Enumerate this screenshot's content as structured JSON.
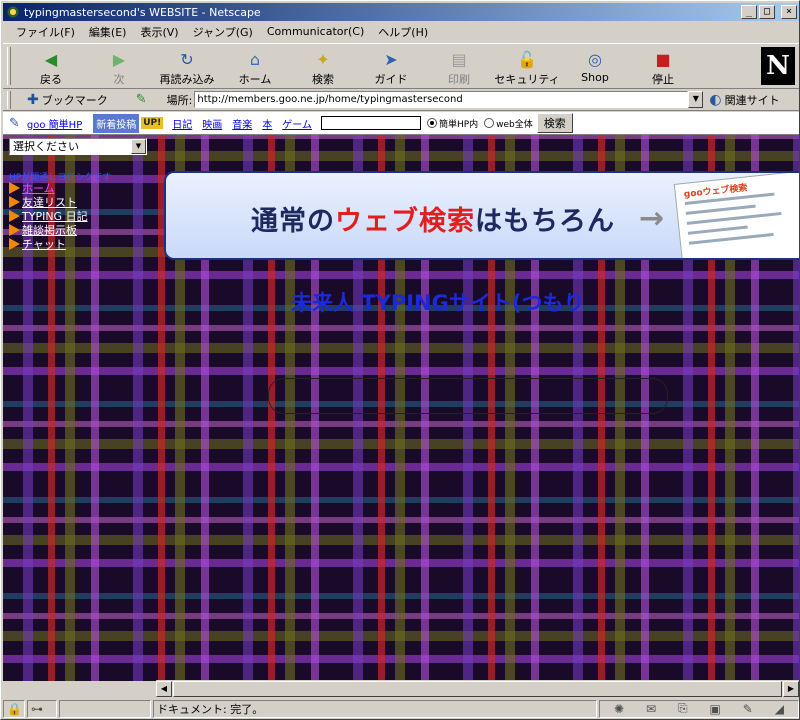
{
  "window": {
    "title": "typingmastersecond's WEBSITE - Netscape",
    "controls": {
      "minimize": "_",
      "maximize": "□",
      "close": "×"
    }
  },
  "menu": [
    "ファイル(F)",
    "編集(E)",
    "表示(V)",
    "ジャンプ(G)",
    "Communicator(C)",
    "ヘルプ(H)"
  ],
  "toolbar": {
    "buttons": [
      {
        "label": "戻る",
        "icon": "back-icon",
        "glyph": "◀"
      },
      {
        "label": "次",
        "icon": "forward-icon",
        "glyph": "▶"
      },
      {
        "label": "再読み込み",
        "icon": "reload-icon",
        "glyph": "↻"
      },
      {
        "label": "ホーム",
        "icon": "home-icon",
        "glyph": "⌂"
      },
      {
        "label": "検索",
        "icon": "search-icon",
        "glyph": "✦"
      },
      {
        "label": "ガイド",
        "icon": "guide-icon",
        "glyph": "➤"
      },
      {
        "label": "印刷",
        "icon": "print-icon",
        "glyph": "▤"
      },
      {
        "label": "セキュリティ",
        "icon": "lock-icon",
        "glyph": "🔓"
      },
      {
        "label": "Shop",
        "icon": "shop-icon",
        "glyph": "◎"
      },
      {
        "label": "停止",
        "icon": "stop-icon",
        "glyph": "■"
      }
    ],
    "logo": "N"
  },
  "location": {
    "bookmark_label": "ブックマーク",
    "label": "場所:",
    "url": "http://members.goo.ne.jp/home/typingmastersecond",
    "related_label": "関連サイト"
  },
  "goobar": {
    "home_link": "goo 簡単HP",
    "new_label": "新着投稿",
    "up_badge": "UP!",
    "links": [
      "日記",
      "映画",
      "音楽",
      "本",
      "ゲーム"
    ],
    "search_value": "",
    "radio1": "簡単HP内",
    "radio2": "web全体",
    "search_button": "検索"
  },
  "content": {
    "select_value": "選択ください",
    "sidebar_heading": "HPが開通しヨロシクです",
    "nav": [
      "ホーム",
      "友達リスト",
      "TYPING 日記",
      "雑談掲示板",
      "チャット"
    ],
    "banner": {
      "part1": "通常の",
      "highlight": "ウェブ検索",
      "part2": "はもちろん",
      "arrow": "→",
      "shot_title": "gooウェブ検索"
    },
    "site_title": "未来人 TYPINGサイト(つもり"
  },
  "status": {
    "text": "ドキュメント: 完了。"
  },
  "colors": {
    "titlebar_start": "#0a246a",
    "titlebar_end": "#a6caf0",
    "site_title": "#1a2ad8",
    "nav_bullet": "#f08a00"
  }
}
